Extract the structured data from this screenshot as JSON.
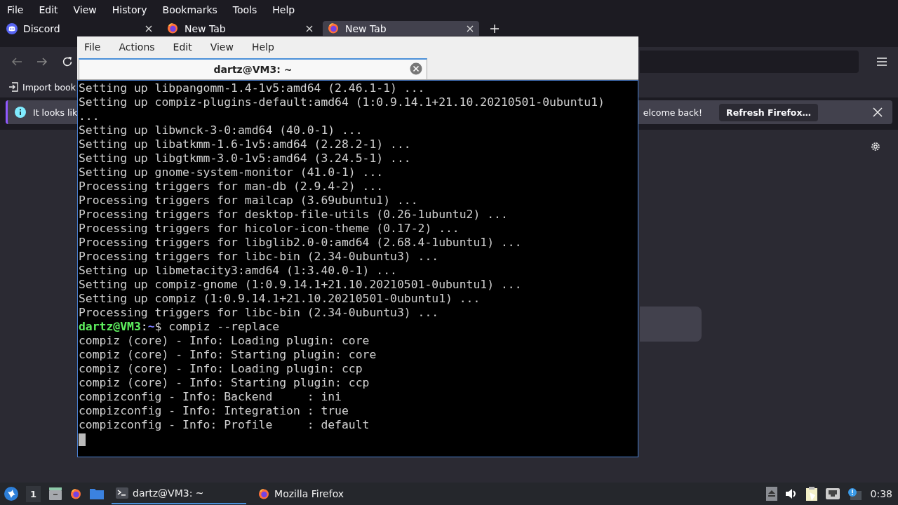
{
  "browser": {
    "menu": [
      "File",
      "Edit",
      "View",
      "History",
      "Bookmarks",
      "Tools",
      "Help"
    ],
    "tabs": [
      {
        "label": "Discord",
        "selected": false,
        "kind": "discord"
      },
      {
        "label": "New Tab",
        "selected": false,
        "kind": "firefox"
      },
      {
        "label": "New Tab",
        "selected": true,
        "kind": "firefox"
      }
    ],
    "bookmarks": [
      "Import book"
    ],
    "notification": {
      "text_start": "It looks lik",
      "text_end": "elcome back!",
      "button": "Refresh Firefox…"
    }
  },
  "terminal": {
    "menu": [
      "File",
      "Actions",
      "Edit",
      "View",
      "Help"
    ],
    "tab": {
      "title": "dartz@VM3: ~",
      "selected": true
    },
    "lines": [
      {
        "kind": "output",
        "text": "Setting up libpangomm-1.4-1v5:amd64 (2.46.1-1) ..."
      },
      {
        "kind": "output",
        "text": "Setting up compiz-plugins-default:amd64 (1:0.9.14.1+21.10.20210501-0ubuntu1)"
      },
      {
        "kind": "output",
        "text": "..."
      },
      {
        "kind": "output",
        "text": "Setting up libwnck-3-0:amd64 (40.0-1) ..."
      },
      {
        "kind": "output",
        "text": "Setting up libatkmm-1.6-1v5:amd64 (2.28.2-1) ..."
      },
      {
        "kind": "output",
        "text": "Setting up libgtkmm-3.0-1v5:amd64 (3.24.5-1) ..."
      },
      {
        "kind": "output",
        "text": "Setting up gnome-system-monitor (41.0-1) ..."
      },
      {
        "kind": "output",
        "text": "Processing triggers for man-db (2.9.4-2) ..."
      },
      {
        "kind": "output",
        "text": "Processing triggers for mailcap (3.69ubuntu1) ..."
      },
      {
        "kind": "output",
        "text": "Processing triggers for desktop-file-utils (0.26-1ubuntu2) ..."
      },
      {
        "kind": "output",
        "text": "Processing triggers for hicolor-icon-theme (0.17-2) ..."
      },
      {
        "kind": "output",
        "text": "Processing triggers for libglib2.0-0:amd64 (2.68.4-1ubuntu1) ..."
      },
      {
        "kind": "output",
        "text": "Processing triggers for libc-bin (2.34-0ubuntu3) ..."
      },
      {
        "kind": "output",
        "text": "Setting up libmetacity3:amd64 (1:3.40.0-1) ..."
      },
      {
        "kind": "output",
        "text": "Setting up compiz-gnome (1:0.9.14.1+21.10.20210501-0ubuntu1) ..."
      },
      {
        "kind": "output",
        "text": "Setting up compiz (1:0.9.14.1+21.10.20210501-0ubuntu1) ..."
      },
      {
        "kind": "output",
        "text": "Processing triggers for libc-bin (2.34-0ubuntu3) ..."
      },
      {
        "kind": "prompt",
        "user": "dartz@VM3",
        "sep": ":",
        "path": "~",
        "command": "$ compiz --replace"
      },
      {
        "kind": "output",
        "text": "compiz (core) - Info: Loading plugin: core"
      },
      {
        "kind": "output",
        "text": "compiz (core) - Info: Starting plugin: core"
      },
      {
        "kind": "output",
        "text": "compiz (core) - Info: Loading plugin: ccp"
      },
      {
        "kind": "output",
        "text": "compiz (core) - Info: Starting plugin: ccp"
      },
      {
        "kind": "output",
        "text": "compizconfig - Info: Backend     : ini"
      },
      {
        "kind": "output",
        "text": "compizconfig - Info: Integration : true"
      },
      {
        "kind": "output",
        "text": "compizconfig - Info: Profile     : default"
      },
      {
        "kind": "cursor"
      }
    ]
  },
  "taskbar": {
    "workspace": "1",
    "tasks": [
      {
        "label": "dartz@VM3: ~",
        "selected": true,
        "kind": "terminal"
      },
      {
        "label": "Mozilla Firefox",
        "selected": false,
        "kind": "firefox"
      }
    ],
    "clock": "0:38"
  }
}
